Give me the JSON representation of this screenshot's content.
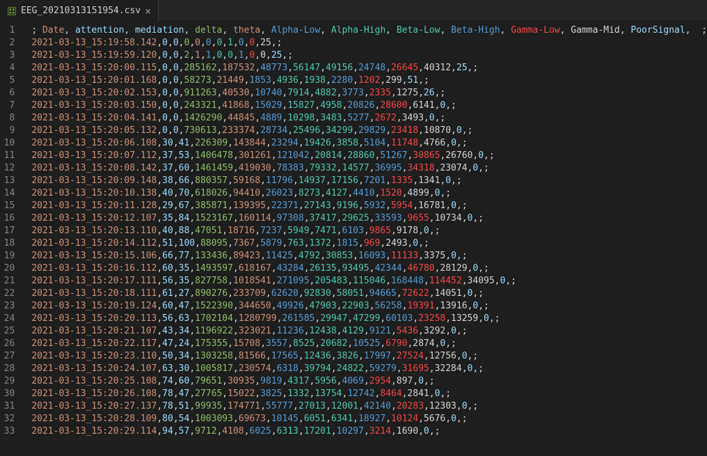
{
  "tab": {
    "filename": "EEG_20210313151954.csv",
    "icon": "csv-file-icon",
    "close": "×"
  },
  "header": {
    "fields": [
      {
        "t": "; ",
        "c": "fg"
      },
      {
        "t": "Date",
        "c": "orange"
      },
      {
        "t": ", ",
        "c": "fg"
      },
      {
        "t": "attention",
        "c": "cyan"
      },
      {
        "t": ", ",
        "c": "fg"
      },
      {
        "t": "mediation",
        "c": "cyan"
      },
      {
        "t": ", ",
        "c": "fg"
      },
      {
        "t": "delta",
        "c": "green"
      },
      {
        "t": ", ",
        "c": "fg"
      },
      {
        "t": "theta",
        "c": "orange"
      },
      {
        "t": ", ",
        "c": "fg"
      },
      {
        "t": "Alpha-Low",
        "c": "blue"
      },
      {
        "t": ", ",
        "c": "fg"
      },
      {
        "t": "Alpha-High",
        "c": "teal"
      },
      {
        "t": ", ",
        "c": "fg"
      },
      {
        "t": "Beta-Low",
        "c": "teal"
      },
      {
        "t": ", ",
        "c": "fg"
      },
      {
        "t": "Beta-High",
        "c": "blue"
      },
      {
        "t": ", ",
        "c": "fg"
      },
      {
        "t": "Gamma-Low",
        "c": "red"
      },
      {
        "t": ", ",
        "c": "fg"
      },
      {
        "t": "Gamma-Mid",
        "c": "fg"
      },
      {
        "t": ", ",
        "c": "fg"
      },
      {
        "t": "PoorSignal",
        "c": "cyan"
      },
      {
        "t": ", ",
        "c": "fg"
      },
      {
        "t": " ;",
        "c": "fg"
      }
    ]
  },
  "rows": [
    {
      "ts": "2021-03-13_15:19:58.142",
      "v": [
        0,
        0,
        0,
        0,
        0,
        0,
        1,
        0,
        0,
        25
      ]
    },
    {
      "ts": "2021-03-13_15:19:59.120",
      "v": [
        0,
        0,
        2,
        1,
        1,
        0,
        0,
        1,
        0,
        0,
        25
      ]
    },
    {
      "ts": "2021-03-13_15:20:00.115",
      "v": [
        0,
        0,
        285162,
        187532,
        48773,
        56147,
        49156,
        24748,
        26645,
        40312,
        25
      ]
    },
    {
      "ts": "2021-03-13_15:20:01.168",
      "v": [
        0,
        0,
        58273,
        21449,
        1853,
        4936,
        1938,
        2280,
        1202,
        299,
        51
      ]
    },
    {
      "ts": "2021-03-13_15:20:02.153",
      "v": [
        0,
        0,
        911263,
        40530,
        10740,
        7914,
        4882,
        3773,
        2335,
        1275,
        26
      ]
    },
    {
      "ts": "2021-03-13_15:20:03.150",
      "v": [
        0,
        0,
        243321,
        41868,
        15029,
        15827,
        4958,
        20826,
        28600,
        6141,
        0
      ]
    },
    {
      "ts": "2021-03-13_15:20:04.141",
      "v": [
        0,
        0,
        1426290,
        44845,
        4889,
        10298,
        3483,
        5277,
        2672,
        3493,
        0
      ]
    },
    {
      "ts": "2021-03-13_15:20:05.132",
      "v": [
        0,
        0,
        730613,
        233374,
        28734,
        25496,
        34299,
        29829,
        23418,
        10870,
        0
      ]
    },
    {
      "ts": "2021-03-13_15:20:06.108",
      "v": [
        30,
        41,
        226309,
        143844,
        23294,
        19426,
        3858,
        5104,
        11748,
        4766,
        0
      ]
    },
    {
      "ts": "2021-03-13_15:20:07.112",
      "v": [
        37,
        53,
        1406478,
        301261,
        121042,
        20814,
        28860,
        51267,
        30865,
        26760,
        0
      ]
    },
    {
      "ts": "2021-03-13_15:20:08.142",
      "v": [
        37,
        60,
        1461459,
        419030,
        78383,
        79332,
        14577,
        36995,
        34318,
        23074,
        0
      ]
    },
    {
      "ts": "2021-03-13_15:20:09.148",
      "v": [
        38,
        66,
        880357,
        59168,
        11796,
        14937,
        17156,
        7201,
        1335,
        1341,
        0
      ]
    },
    {
      "ts": "2021-03-13_15:20:10.138",
      "v": [
        40,
        70,
        618026,
        94410,
        26023,
        8273,
        4127,
        4410,
        1520,
        4899,
        0
      ]
    },
    {
      "ts": "2021-03-13_15:20:11.128",
      "v": [
        29,
        67,
        385871,
        139395,
        22371,
        27143,
        9196,
        5932,
        5954,
        16781,
        0
      ]
    },
    {
      "ts": "2021-03-13_15:20:12.107",
      "v": [
        35,
        84,
        1523167,
        160114,
        97308,
        37417,
        29625,
        33593,
        9655,
        10734,
        0
      ]
    },
    {
      "ts": "2021-03-13_15:20:13.110",
      "v": [
        40,
        88,
        47051,
        18716,
        7237,
        5949,
        7471,
        6103,
        9865,
        9178,
        0
      ]
    },
    {
      "ts": "2021-03-13_15:20:14.112",
      "v": [
        51,
        100,
        88095,
        7367,
        5879,
        763,
        1372,
        1815,
        969,
        2493,
        0
      ]
    },
    {
      "ts": "2021-03-13_15:20:15.106",
      "v": [
        66,
        77,
        133436,
        89423,
        11425,
        4792,
        30853,
        16093,
        11133,
        3375,
        0
      ]
    },
    {
      "ts": "2021-03-13_15:20:16.112",
      "v": [
        60,
        35,
        1493597,
        618167,
        43284,
        26135,
        93495,
        42344,
        46780,
        28129,
        0
      ]
    },
    {
      "ts": "2021-03-13_15:20:17.111",
      "v": [
        56,
        35,
        827758,
        1018541,
        271095,
        205483,
        115046,
        168448,
        114452,
        34095,
        0
      ]
    },
    {
      "ts": "2021-03-13_15:20:18.111",
      "v": [
        61,
        27,
        890276,
        233709,
        62620,
        92830,
        58051,
        94665,
        72622,
        14051,
        0
      ]
    },
    {
      "ts": "2021-03-13_15:20:19.124",
      "v": [
        60,
        47,
        1522390,
        344650,
        49926,
        47903,
        22903,
        56258,
        19391,
        13916,
        0
      ]
    },
    {
      "ts": "2021-03-13_15:20:20.113",
      "v": [
        56,
        63,
        1702104,
        1280799,
        261585,
        29947,
        47299,
        60103,
        23258,
        13259,
        0
      ]
    },
    {
      "ts": "2021-03-13_15:20:21.107",
      "v": [
        43,
        34,
        1196922,
        323021,
        11236,
        12438,
        4129,
        9121,
        5436,
        3292,
        0
      ]
    },
    {
      "ts": "2021-03-13_15:20:22.117",
      "v": [
        47,
        24,
        175355,
        15708,
        3557,
        8525,
        20682,
        10525,
        6790,
        2874,
        0
      ]
    },
    {
      "ts": "2021-03-13_15:20:23.110",
      "v": [
        50,
        34,
        1303258,
        81566,
        17565,
        12436,
        3826,
        17997,
        27524,
        12756,
        0
      ]
    },
    {
      "ts": "2021-03-13_15:20:24.107",
      "v": [
        63,
        30,
        1005817,
        230574,
        6318,
        39794,
        24822,
        59279,
        31695,
        32284,
        0
      ]
    },
    {
      "ts": "2021-03-13_15:20:25.108",
      "v": [
        74,
        60,
        79651,
        30935,
        9819,
        4317,
        5956,
        4069,
        2954,
        897,
        0
      ]
    },
    {
      "ts": "2021-03-13_15:20:26.108",
      "v": [
        78,
        47,
        27765,
        15022,
        3825,
        1332,
        13754,
        12742,
        8464,
        2841,
        0
      ]
    },
    {
      "ts": "2021-03-13_15:20:27.137",
      "v": [
        78,
        51,
        99935,
        174771,
        55777,
        27013,
        12001,
        42140,
        20283,
        12303,
        0
      ]
    },
    {
      "ts": "2021-03-13_15:20:28.109",
      "v": [
        80,
        54,
        1003093,
        69673,
        10145,
        6051,
        6341,
        18927,
        10124,
        5676,
        0
      ]
    },
    {
      "ts": "2021-03-13_15:20:29.114",
      "v": [
        94,
        57,
        9712,
        4108,
        6025,
        6313,
        17201,
        10297,
        3214,
        1690,
        0
      ]
    }
  ],
  "colors": {
    "columnClass": [
      "cyan",
      "cyan",
      "green",
      "orange",
      "blue",
      "teal",
      "teal",
      "blue",
      "red",
      "fg",
      "cyan"
    ]
  }
}
